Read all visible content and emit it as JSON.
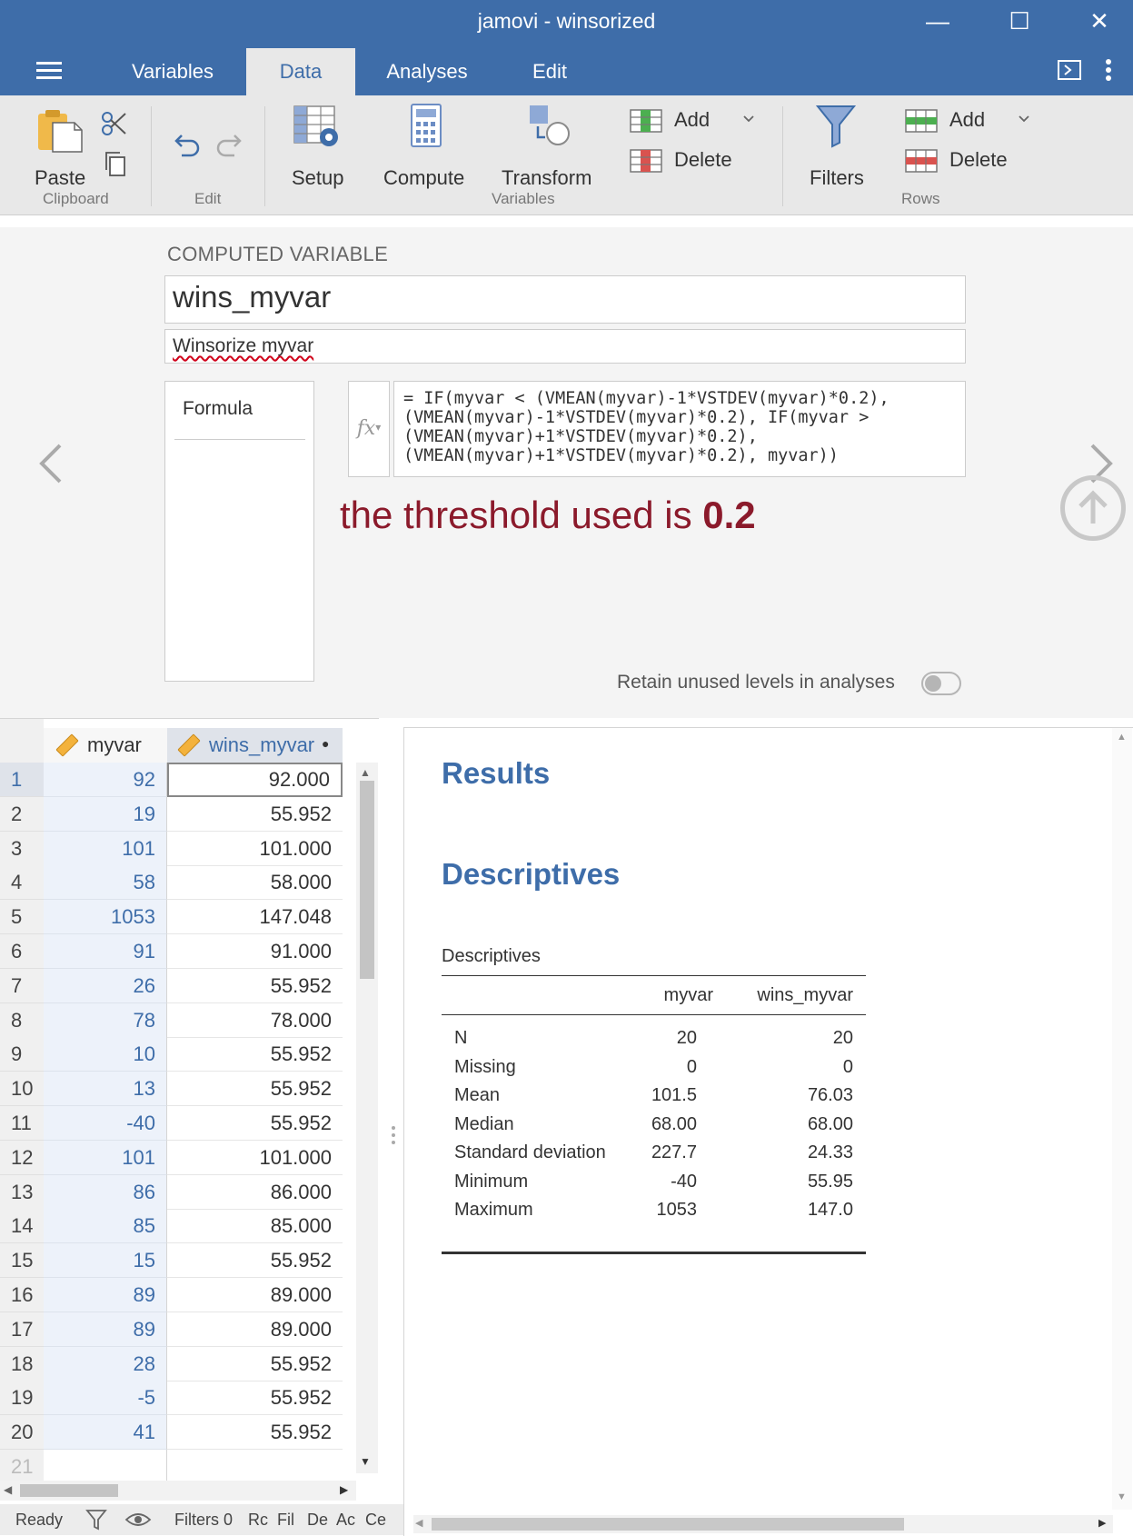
{
  "window": {
    "title": "jamovi - winsorized",
    "minimize_glyph": "—",
    "maximize_glyph": "☐",
    "close_glyph": "✕"
  },
  "tabs": [
    {
      "label": "Variables"
    },
    {
      "label": "Data"
    },
    {
      "label": "Analyses"
    },
    {
      "label": "Edit"
    }
  ],
  "ribbon": {
    "paste": "Paste",
    "clipboard_group": "Clipboard",
    "edit_group": "Edit",
    "setup": "Setup",
    "compute": "Compute",
    "transform": "Transform",
    "variables_group": "Variables",
    "add_var": "Add",
    "delete_var": "Delete",
    "filters": "Filters",
    "add_row": "Add",
    "delete_row": "Delete",
    "rows_group": "Rows"
  },
  "computed": {
    "heading": "COMPUTED VARIABLE",
    "name": "wins_myvar",
    "description": "Winsorize myvar",
    "formula_tab": "Formula",
    "fx": "fx",
    "formula": "= IF(myvar < (VMEAN(myvar)-1*VSTDEV(myvar)*0.2),\n(VMEAN(myvar)-1*VSTDEV(myvar)*0.2), IF(myvar >\n(VMEAN(myvar)+1*VSTDEV(myvar)*0.2),\n(VMEAN(myvar)+1*VSTDEV(myvar)*0.2), myvar))",
    "threshold_prefix": "the threshold used is ",
    "threshold_value": "0.2",
    "retain_label": "Retain unused levels in analyses",
    "retain_on": false
  },
  "spreadsheet": {
    "columns": [
      "myvar",
      "wins_myvar"
    ],
    "rows": [
      {
        "n": "1",
        "a": "92",
        "b": "92.000"
      },
      {
        "n": "2",
        "a": "19",
        "b": "55.952"
      },
      {
        "n": "3",
        "a": "101",
        "b": "101.000"
      },
      {
        "n": "4",
        "a": "58",
        "b": "58.000"
      },
      {
        "n": "5",
        "a": "1053",
        "b": "147.048"
      },
      {
        "n": "6",
        "a": "91",
        "b": "91.000"
      },
      {
        "n": "7",
        "a": "26",
        "b": "55.952"
      },
      {
        "n": "8",
        "a": "78",
        "b": "78.000"
      },
      {
        "n": "9",
        "a": "10",
        "b": "55.952"
      },
      {
        "n": "10",
        "a": "13",
        "b": "55.952"
      },
      {
        "n": "11",
        "a": "-40",
        "b": "55.952"
      },
      {
        "n": "12",
        "a": "101",
        "b": "101.000"
      },
      {
        "n": "13",
        "a": "86",
        "b": "86.000"
      },
      {
        "n": "14",
        "a": "85",
        "b": "85.000"
      },
      {
        "n": "15",
        "a": "15",
        "b": "55.952"
      },
      {
        "n": "16",
        "a": "89",
        "b": "89.000"
      },
      {
        "n": "17",
        "a": "89",
        "b": "89.000"
      },
      {
        "n": "18",
        "a": "28",
        "b": "55.952"
      },
      {
        "n": "19",
        "a": "-5",
        "b": "55.952"
      },
      {
        "n": "20",
        "a": "41",
        "b": "55.952"
      },
      {
        "n": "21",
        "a": "",
        "b": ""
      }
    ]
  },
  "results": {
    "title": "Results",
    "section": "Descriptives",
    "table_title": "Descriptives",
    "columns": [
      "myvar",
      "wins_myvar"
    ],
    "rows": [
      {
        "label": "N",
        "a": "20",
        "b": "20"
      },
      {
        "label": "Missing",
        "a": "0",
        "b": "0"
      },
      {
        "label": "Mean",
        "a": "101.5",
        "b": "76.03"
      },
      {
        "label": "Median",
        "a": "68.00",
        "b": "68.00"
      },
      {
        "label": "Standard deviation",
        "a": "227.7",
        "b": "24.33"
      },
      {
        "label": "Minimum",
        "a": "-40",
        "b": "55.95"
      },
      {
        "label": "Maximum",
        "a": "1053",
        "b": "147.0"
      }
    ]
  },
  "statusbar": {
    "ready": "Ready",
    "filters": "Filters 0",
    "truncated": [
      "Rc",
      "Fil",
      "De",
      "Ac",
      "Ce"
    ]
  },
  "colors": {
    "accent": "#3e6da9",
    "threshold_text": "#8b1a2b",
    "ribbon_bg": "#e8e8e8"
  }
}
